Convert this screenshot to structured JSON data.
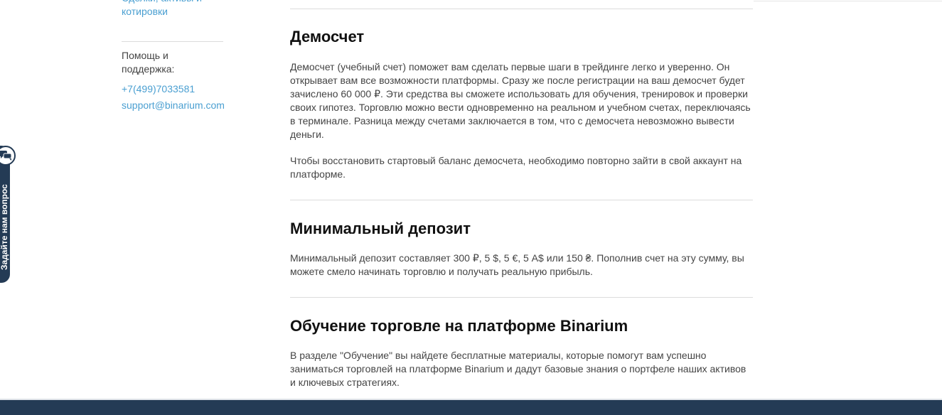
{
  "sidebar": {
    "clipped_link": "Сделки, активы и котировки",
    "help_label": "Помощь и поддержка:",
    "phone": "+7(499)7033581",
    "email": "support@binarium.com"
  },
  "sections": [
    {
      "title": "Демосчет",
      "paragraphs": [
        "Демосчет (учебный счет) поможет вам сделать первые шаги в трейдинге легко и уверенно. Он открывает вам все возможности платформы. Сразу же после регистрации на ваш демосчет будет зачислено 60 000 ₽. Эти средства вы сможете использовать для обучения, тренировок и проверки своих гипотез. Торговлю можно вести одновременно на реальном и учебном счетах, переключаясь в терминале. Разница между счетами заключается в том, что с демосчета невозможно вывести деньги.",
        "Чтобы восстановить стартовый баланс демосчета, необходимо повторно зайти в свой аккаунт на платформе."
      ]
    },
    {
      "title": "Минимальный депозит",
      "paragraphs": [
        "Минимальный депозит составляет 300 ₽, 5 $, 5 €, 5 A$ или 150 ₴. Пополнив счет на эту сумму, вы можете смело начинать торговлю и получать реальную прибыль."
      ]
    },
    {
      "title": "Обучение торговле на платформе Binarium",
      "paragraphs": [
        "В разделе \"Обучение\" вы найдете бесплатные материалы, которые помогут вам успешно заниматься торговлей на платформе Binarium и дадут базовые знания о портфеле наших активов и ключевых стратегиях."
      ]
    }
  ],
  "ask_widget": {
    "label": "Задайте нам вопрос",
    "icon": "chat-bubbles-icon"
  },
  "colors": {
    "link": "#4a9fd1",
    "footer": "#243b55",
    "heading": "#111111",
    "text": "#444444"
  }
}
